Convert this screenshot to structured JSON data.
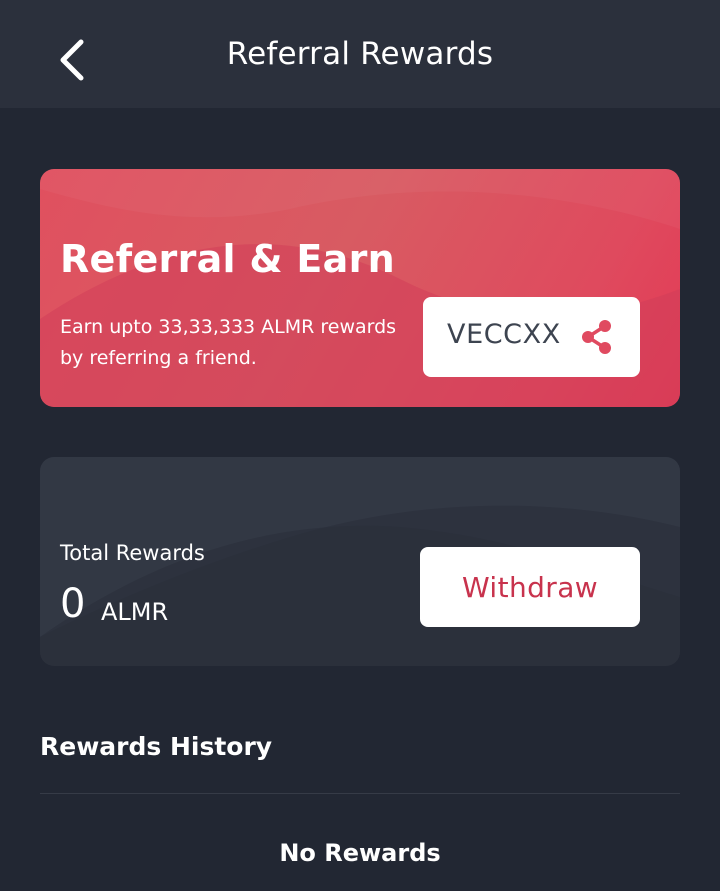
{
  "header": {
    "title": "Referral Rewards",
    "back_icon": "chevron-left-icon"
  },
  "referral": {
    "heading": "Referral & Earn",
    "description": "Earn upto 33,33,333 ALMR rewards by referring a friend.",
    "code": "VECCXX",
    "share_icon": "share-icon",
    "accent_color": "#e0505f"
  },
  "rewards": {
    "label": "Total Rewards",
    "amount": "0",
    "unit": "ALMR",
    "withdraw_label": "Withdraw",
    "withdraw_color": "#c8334d"
  },
  "history": {
    "title": "Rewards History",
    "empty_text": "No Rewards"
  }
}
